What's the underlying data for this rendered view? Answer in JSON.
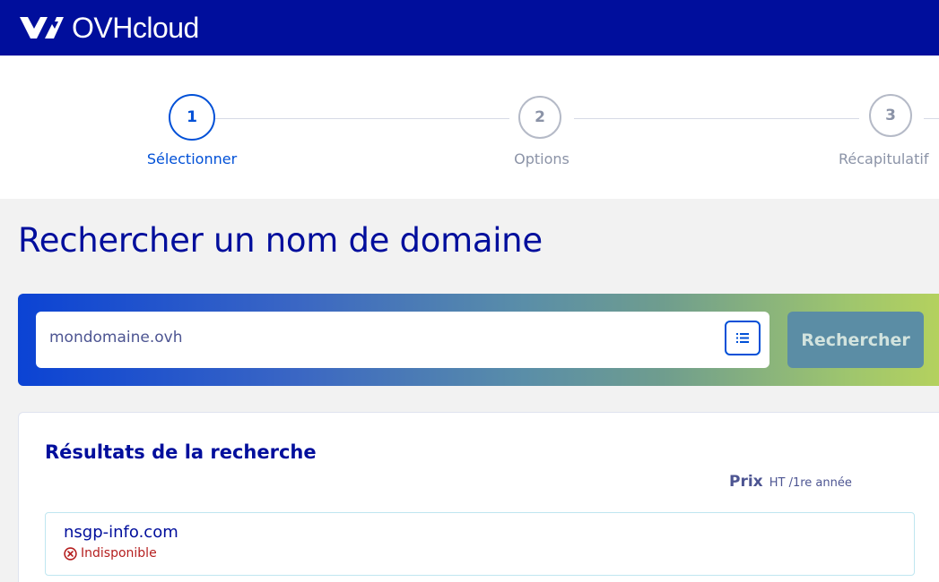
{
  "header": {
    "brand": "OVHcloud",
    "logo_icon": "ovh-logo-icon",
    "background": "#000e9c"
  },
  "stepper": {
    "steps": [
      {
        "number": "1",
        "label": "Sélectionner",
        "active": true
      },
      {
        "number": "2",
        "label": "Options",
        "active": false
      },
      {
        "number": "3",
        "label": "Récapitulatif",
        "active": false
      }
    ],
    "active_color": "#0050d7"
  },
  "search": {
    "title": "Rechercher un nom de domaine",
    "value": "mondomaine.ovh",
    "list_icon": "list-icon",
    "button_label": "Rechercher"
  },
  "results": {
    "title": "Résultats de la recherche",
    "price_label": "Prix",
    "price_sub": "HT /1re année",
    "items": [
      {
        "domain": "nsgp-info.com",
        "status": "Indisponible",
        "status_icon": "unavailable-icon",
        "status_color": "#b51f1f"
      }
    ]
  }
}
